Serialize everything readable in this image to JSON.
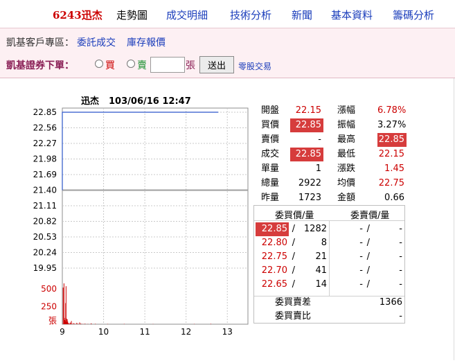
{
  "nav": {
    "stock": "6243迅杰",
    "current": "走勢圖",
    "links": [
      "成交明細",
      "技術分析",
      "新聞",
      "基本資料",
      "籌碼分析"
    ]
  },
  "bar": {
    "area_label": "凱基客戶專區：",
    "link_orders": "委託成交",
    "link_inventory": "庫存報價",
    "order_title": "凱基證券下單：",
    "buy_label": "買",
    "sell_label": "賣",
    "qty_value": "",
    "unit": "張",
    "submit": "送出",
    "odd_lot": "零股交易"
  },
  "chart_header": {
    "name": "迅杰",
    "datetime": "103/06/16 12:47"
  },
  "chart_data": {
    "type": "line",
    "title": "迅杰 103/06/16 12:47",
    "y_ticks": [
      "22.85",
      "22.56",
      "22.27",
      "21.98",
      "21.69",
      "21.40",
      "21.11",
      "20.82",
      "20.53",
      "20.24",
      "19.95"
    ],
    "ylim": [
      19.95,
      22.85
    ],
    "reference_price": 21.4,
    "x_ticks": [
      "9",
      "10",
      "11",
      "12",
      "13"
    ],
    "xlim": [
      9,
      13.5
    ],
    "price_series": {
      "x": [
        9.0,
        9.03,
        9.05,
        12.78
      ],
      "y": [
        22.85,
        22.85,
        22.85,
        22.85
      ]
    },
    "volume": {
      "ylabel": "張",
      "y_ticks": [
        "500",
        "250"
      ],
      "ylim": [
        0,
        620
      ],
      "x": [
        9.02,
        9.04,
        9.05,
        9.06,
        9.07,
        9.08,
        9.09,
        9.1,
        9.11,
        9.12,
        9.13,
        9.14,
        9.15,
        9.17,
        9.19,
        9.2,
        9.22,
        9.24,
        9.27,
        9.3,
        9.35,
        9.38,
        9.42,
        9.45,
        9.5,
        9.55,
        9.62,
        9.7,
        9.8,
        10.1,
        10.5,
        11.2,
        12.2,
        12.6
      ],
      "values": [
        520,
        580,
        90,
        60,
        40,
        300,
        540,
        80,
        30,
        70,
        40,
        20,
        10,
        8,
        25,
        10,
        45,
        5,
        15,
        8,
        20,
        6,
        25,
        10,
        5,
        8,
        4,
        12,
        6,
        4,
        5,
        3,
        4,
        6
      ]
    }
  },
  "quote": [
    {
      "l1": "開盤",
      "v1": "22.15",
      "c1": "red",
      "l2": "漲幅",
      "v2": "6.78%",
      "c2": "red"
    },
    {
      "l1": "買價",
      "v1": "22.85",
      "c1": "hl",
      "l2": "振幅",
      "v2": "3.27%",
      "c2": ""
    },
    {
      "l1": "賣價",
      "v1": "-",
      "c1": "",
      "l2": "最高",
      "v2": "22.85",
      "c2": "hl"
    },
    {
      "l1": "成交",
      "v1": "22.85",
      "c1": "hl",
      "l2": "最低",
      "v2": "22.15",
      "c2": "red"
    },
    {
      "l1": "單量",
      "v1": "1",
      "c1": "",
      "l2": "漲跌",
      "v2": "1.45",
      "c2": "red"
    },
    {
      "l1": "總量",
      "v1": "2922",
      "c1": "",
      "l2": "均價",
      "v2": "22.75",
      "c2": "red"
    },
    {
      "l1": "昨量",
      "v1": "1723",
      "c1": "",
      "l2": "金額",
      "v2": "0.66",
      "c2": ""
    }
  ],
  "book": {
    "head_bid": "委買價/量",
    "head_ask": "委賣價/量",
    "rows": [
      {
        "bp": "22.85",
        "bq": "1282",
        "ap": "-",
        "aq": "-"
      },
      {
        "bp": "22.80",
        "bq": "8",
        "ap": "-",
        "aq": "-"
      },
      {
        "bp": "22.75",
        "bq": "21",
        "ap": "-",
        "aq": "-"
      },
      {
        "bp": "22.70",
        "bq": "41",
        "ap": "-",
        "aq": "-"
      },
      {
        "bp": "22.65",
        "bq": "14",
        "ap": "-",
        "aq": "-"
      }
    ],
    "diff_label": "委買賣差",
    "diff_value": "1366",
    "ratio_label": "委買賣比",
    "ratio_value": "-"
  },
  "colors": {
    "red": "#cc0000",
    "highlight": "#d63c3c",
    "link": "#1a3dbb",
    "pink_bg": "#fdf0f3"
  }
}
